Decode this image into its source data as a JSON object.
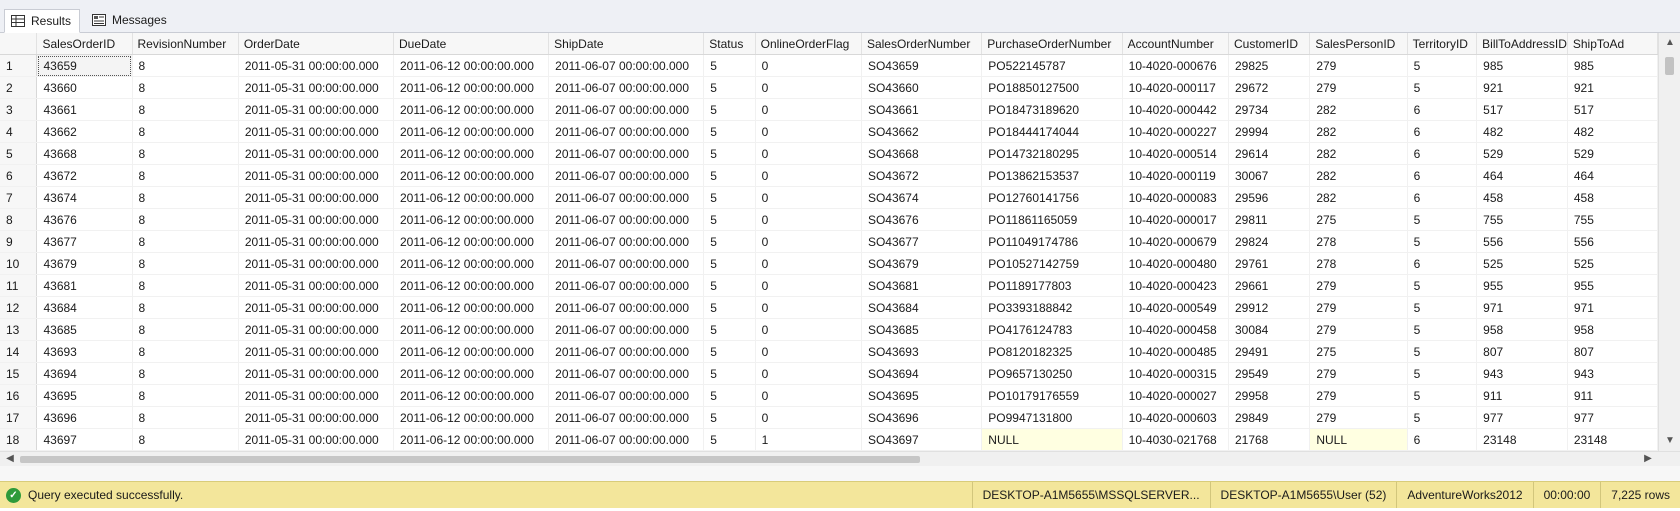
{
  "tabs": {
    "results": "Results",
    "messages": "Messages"
  },
  "columns": [
    "SalesOrderID",
    "RevisionNumber",
    "OrderDate",
    "DueDate",
    "ShipDate",
    "Status",
    "OnlineOrderFlag",
    "SalesOrderNumber",
    "PurchaseOrderNumber",
    "AccountNumber",
    "CustomerID",
    "SalesPersonID",
    "TerritoryID",
    "BillToAddressID",
    "ShipToAd"
  ],
  "rows": [
    [
      "1",
      "43659",
      "8",
      "2011-05-31 00:00:00.000",
      "2011-06-12 00:00:00.000",
      "2011-06-07 00:00:00.000",
      "5",
      "0",
      "SO43659",
      "PO522145787",
      "10-4020-000676",
      "29825",
      "279",
      "5",
      "985",
      "985"
    ],
    [
      "2",
      "43660",
      "8",
      "2011-05-31 00:00:00.000",
      "2011-06-12 00:00:00.000",
      "2011-06-07 00:00:00.000",
      "5",
      "0",
      "SO43660",
      "PO18850127500",
      "10-4020-000117",
      "29672",
      "279",
      "5",
      "921",
      "921"
    ],
    [
      "3",
      "43661",
      "8",
      "2011-05-31 00:00:00.000",
      "2011-06-12 00:00:00.000",
      "2011-06-07 00:00:00.000",
      "5",
      "0",
      "SO43661",
      "PO18473189620",
      "10-4020-000442",
      "29734",
      "282",
      "6",
      "517",
      "517"
    ],
    [
      "4",
      "43662",
      "8",
      "2011-05-31 00:00:00.000",
      "2011-06-12 00:00:00.000",
      "2011-06-07 00:00:00.000",
      "5",
      "0",
      "SO43662",
      "PO18444174044",
      "10-4020-000227",
      "29994",
      "282",
      "6",
      "482",
      "482"
    ],
    [
      "5",
      "43668",
      "8",
      "2011-05-31 00:00:00.000",
      "2011-06-12 00:00:00.000",
      "2011-06-07 00:00:00.000",
      "5",
      "0",
      "SO43668",
      "PO14732180295",
      "10-4020-000514",
      "29614",
      "282",
      "6",
      "529",
      "529"
    ],
    [
      "6",
      "43672",
      "8",
      "2011-05-31 00:00:00.000",
      "2011-06-12 00:00:00.000",
      "2011-06-07 00:00:00.000",
      "5",
      "0",
      "SO43672",
      "PO13862153537",
      "10-4020-000119",
      "30067",
      "282",
      "6",
      "464",
      "464"
    ],
    [
      "7",
      "43674",
      "8",
      "2011-05-31 00:00:00.000",
      "2011-06-12 00:00:00.000",
      "2011-06-07 00:00:00.000",
      "5",
      "0",
      "SO43674",
      "PO12760141756",
      "10-4020-000083",
      "29596",
      "282",
      "6",
      "458",
      "458"
    ],
    [
      "8",
      "43676",
      "8",
      "2011-05-31 00:00:00.000",
      "2011-06-12 00:00:00.000",
      "2011-06-07 00:00:00.000",
      "5",
      "0",
      "SO43676",
      "PO11861165059",
      "10-4020-000017",
      "29811",
      "275",
      "5",
      "755",
      "755"
    ],
    [
      "9",
      "43677",
      "8",
      "2011-05-31 00:00:00.000",
      "2011-06-12 00:00:00.000",
      "2011-06-07 00:00:00.000",
      "5",
      "0",
      "SO43677",
      "PO11049174786",
      "10-4020-000679",
      "29824",
      "278",
      "5",
      "556",
      "556"
    ],
    [
      "10",
      "43679",
      "8",
      "2011-05-31 00:00:00.000",
      "2011-06-12 00:00:00.000",
      "2011-06-07 00:00:00.000",
      "5",
      "0",
      "SO43679",
      "PO10527142759",
      "10-4020-000480",
      "29761",
      "278",
      "6",
      "525",
      "525"
    ],
    [
      "11",
      "43681",
      "8",
      "2011-05-31 00:00:00.000",
      "2011-06-12 00:00:00.000",
      "2011-06-07 00:00:00.000",
      "5",
      "0",
      "SO43681",
      "PO1189177803",
      "10-4020-000423",
      "29661",
      "279",
      "5",
      "955",
      "955"
    ],
    [
      "12",
      "43684",
      "8",
      "2011-05-31 00:00:00.000",
      "2011-06-12 00:00:00.000",
      "2011-06-07 00:00:00.000",
      "5",
      "0",
      "SO43684",
      "PO3393188842",
      "10-4020-000549",
      "29912",
      "279",
      "5",
      "971",
      "971"
    ],
    [
      "13",
      "43685",
      "8",
      "2011-05-31 00:00:00.000",
      "2011-06-12 00:00:00.000",
      "2011-06-07 00:00:00.000",
      "5",
      "0",
      "SO43685",
      "PO4176124783",
      "10-4020-000458",
      "30084",
      "279",
      "5",
      "958",
      "958"
    ],
    [
      "14",
      "43693",
      "8",
      "2011-05-31 00:00:00.000",
      "2011-06-12 00:00:00.000",
      "2011-06-07 00:00:00.000",
      "5",
      "0",
      "SO43693",
      "PO8120182325",
      "10-4020-000485",
      "29491",
      "275",
      "5",
      "807",
      "807"
    ],
    [
      "15",
      "43694",
      "8",
      "2011-05-31 00:00:00.000",
      "2011-06-12 00:00:00.000",
      "2011-06-07 00:00:00.000",
      "5",
      "0",
      "SO43694",
      "PO9657130250",
      "10-4020-000315",
      "29549",
      "279",
      "5",
      "943",
      "943"
    ],
    [
      "16",
      "43695",
      "8",
      "2011-05-31 00:00:00.000",
      "2011-06-12 00:00:00.000",
      "2011-06-07 00:00:00.000",
      "5",
      "0",
      "SO43695",
      "PO10179176559",
      "10-4020-000027",
      "29958",
      "279",
      "5",
      "911",
      "911"
    ],
    [
      "17",
      "43696",
      "8",
      "2011-05-31 00:00:00.000",
      "2011-06-12 00:00:00.000",
      "2011-06-07 00:00:00.000",
      "5",
      "0",
      "SO43696",
      "PO9947131800",
      "10-4020-000603",
      "29849",
      "279",
      "5",
      "977",
      "977"
    ],
    [
      "18",
      "43697",
      "8",
      "2011-05-31 00:00:00.000",
      "2011-06-12 00:00:00.000",
      "2011-06-07 00:00:00.000",
      "5",
      "1",
      "SO43697",
      "NULL",
      "10-4030-021768",
      "21768",
      "NULL",
      "6",
      "23148",
      "23148"
    ]
  ],
  "status": {
    "message": "Query executed successfully.",
    "server": "DESKTOP-A1M5655\\MSSQLSERVER...",
    "user": "DESKTOP-A1M5655\\User (52)",
    "database": "AdventureWorks2012",
    "elapsed": "00:00:00",
    "rowcount": "7,225 rows"
  },
  "colors": {
    "status_bar": "#f3e69b",
    "null_cell": "#ffffe1",
    "success": "#2e9a3a"
  },
  "icons": {
    "results_tab": "grid-icon",
    "messages_tab": "messages-icon",
    "status": "check-circle-icon"
  }
}
